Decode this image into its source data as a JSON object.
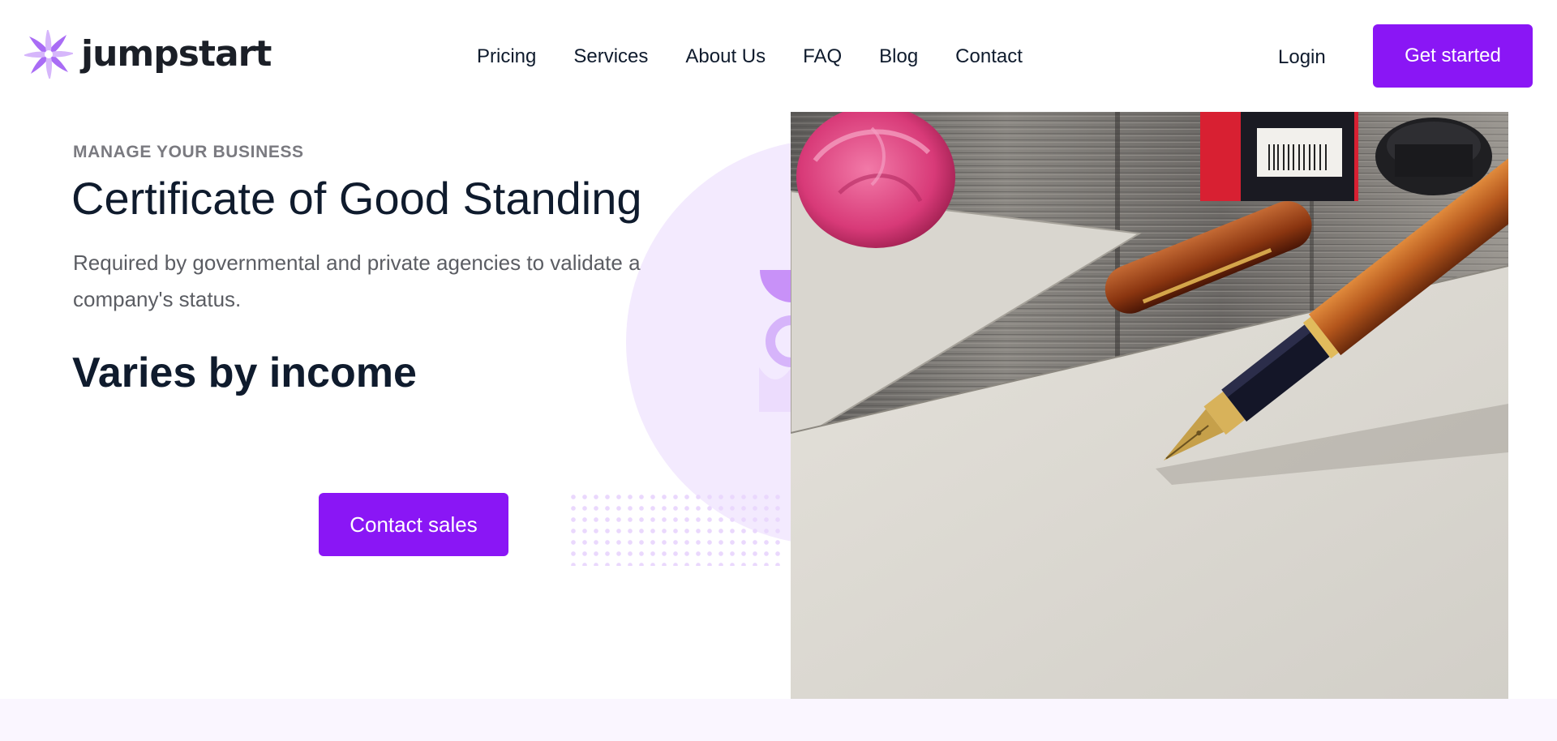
{
  "brand": {
    "name": "jumpstart",
    "logo_icon": "pinwheel-logo-icon",
    "accent_color": "#8a16f5"
  },
  "nav": {
    "links": [
      {
        "label": "Pricing"
      },
      {
        "label": "Services"
      },
      {
        "label": "About Us"
      },
      {
        "label": "FAQ"
      },
      {
        "label": "Blog"
      },
      {
        "label": "Contact"
      }
    ],
    "login_label": "Login",
    "cta_label": "Get started"
  },
  "hero": {
    "eyebrow": "MANAGE YOUR BUSINESS",
    "title": "Certificate of Good Standing",
    "description": "Required by governmental and private agencies to validate a company's status.",
    "price": "Varies by income",
    "cta_label": "Contact sales",
    "image_subject": "fountain pen resting on cream paper beside a pink rose, ink bottle and pen cap on a wooden table"
  }
}
